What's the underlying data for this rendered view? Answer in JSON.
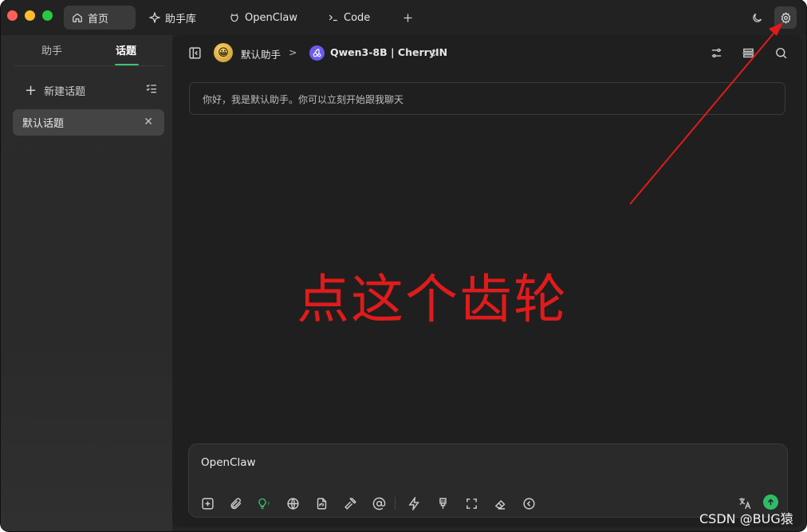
{
  "tabs": [
    {
      "label": "首页",
      "icon": "home-icon"
    },
    {
      "label": "助手库",
      "icon": "sparkle-icon"
    },
    {
      "label": "OpenClaw",
      "icon": "claw-icon"
    },
    {
      "label": "Code",
      "icon": "terminal-icon"
    }
  ],
  "sidebar": {
    "tab_assistant": "助手",
    "tab_topics": "话题",
    "new_topic": "新建话题",
    "topics": [
      "默认话题"
    ]
  },
  "header": {
    "assistant_avatar": "😀",
    "assistant_name": "默认助手",
    "separator": ">",
    "model_name": "Qwen3-8B | CherryIN"
  },
  "chat": {
    "welcome_message": "你好，我是默认助手。你可以立刻开始跟我聊天"
  },
  "composer": {
    "value": "OpenClaw"
  },
  "annotation": {
    "text": "点这个齿轮",
    "color": "#e01b1b"
  },
  "watermark": "CSDN @BUG猿",
  "colors": {
    "accent": "#3cc270",
    "send": "#2ebd66",
    "annotation": "#e01b1b"
  }
}
